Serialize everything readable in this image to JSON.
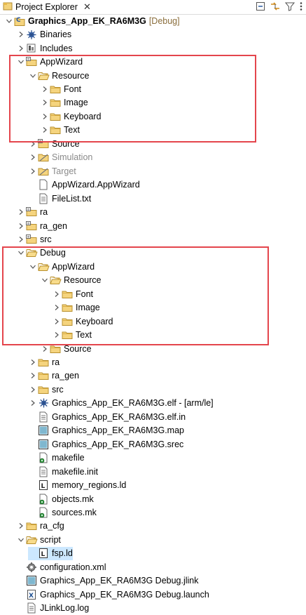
{
  "view": {
    "tab_label": "Project Explorer",
    "close_glyph": "✕"
  },
  "colors": {
    "folder": "#e6b84a",
    "highlight": "#e4454c",
    "muted_text": "#8a8a8a",
    "decoration": "#8a6d3b"
  },
  "tree": [
    {
      "label": "Graphics_App_EK_RA6M3G",
      "decoration": "[Debug]",
      "icon": "project-icon",
      "expanded": true,
      "depth": 0,
      "bold": true
    },
    {
      "label": "Binaries",
      "icon": "binaries-icon",
      "expanded": false,
      "depth": 1
    },
    {
      "label": "Includes",
      "icon": "includes-icon",
      "expanded": false,
      "depth": 1
    },
    {
      "label": "AppWizard",
      "icon": "source-folder-icon",
      "expanded": true,
      "depth": 1
    },
    {
      "label": "Resource",
      "icon": "folder-open-icon",
      "expanded": true,
      "depth": 2
    },
    {
      "label": "Font",
      "icon": "folder-icon",
      "expanded": false,
      "depth": 3
    },
    {
      "label": "Image",
      "icon": "folder-icon",
      "expanded": false,
      "depth": 3
    },
    {
      "label": "Keyboard",
      "icon": "folder-icon",
      "expanded": false,
      "depth": 3
    },
    {
      "label": "Text",
      "icon": "folder-icon",
      "expanded": false,
      "depth": 3
    },
    {
      "label": "Source",
      "icon": "source-folder-icon",
      "expanded": false,
      "depth": 2
    },
    {
      "label": "Simulation",
      "icon": "excluded-folder-icon",
      "expanded": false,
      "depth": 2,
      "muted": true
    },
    {
      "label": "Target",
      "icon": "excluded-folder-icon",
      "expanded": false,
      "depth": 2,
      "muted": true
    },
    {
      "label": "AppWizard.AppWizard",
      "icon": "file-icon",
      "depth": 2
    },
    {
      "label": "FileList.txt",
      "icon": "text-file-icon",
      "depth": 2
    },
    {
      "label": "ra",
      "icon": "source-folder-icon",
      "expanded": false,
      "depth": 1
    },
    {
      "label": "ra_gen",
      "icon": "source-folder-icon",
      "expanded": false,
      "depth": 1
    },
    {
      "label": "src",
      "icon": "source-folder-icon",
      "expanded": false,
      "depth": 1
    },
    {
      "label": "Debug",
      "icon": "folder-open-icon",
      "expanded": true,
      "depth": 1
    },
    {
      "label": "AppWizard",
      "icon": "folder-open-icon",
      "expanded": true,
      "depth": 2
    },
    {
      "label": "Resource",
      "icon": "folder-open-icon",
      "expanded": true,
      "depth": 3
    },
    {
      "label": "Font",
      "icon": "folder-icon",
      "expanded": false,
      "depth": 4
    },
    {
      "label": "Image",
      "icon": "folder-icon",
      "expanded": false,
      "depth": 4
    },
    {
      "label": "Keyboard",
      "icon": "folder-icon",
      "expanded": false,
      "depth": 4
    },
    {
      "label": "Text",
      "icon": "folder-icon",
      "expanded": false,
      "depth": 4
    },
    {
      "label": "Source",
      "icon": "folder-icon",
      "expanded": false,
      "depth": 3
    },
    {
      "label": "ra",
      "icon": "folder-icon",
      "expanded": false,
      "depth": 2
    },
    {
      "label": "ra_gen",
      "icon": "folder-icon",
      "expanded": false,
      "depth": 2
    },
    {
      "label": "src",
      "icon": "folder-icon",
      "expanded": false,
      "depth": 2
    },
    {
      "label": "Graphics_App_EK_RA6M3G.elf - [arm/le]",
      "icon": "elf-binary-icon",
      "expanded": false,
      "depth": 2
    },
    {
      "label": "Graphics_App_EK_RA6M3G.elf.in",
      "icon": "text-file-icon",
      "depth": 2
    },
    {
      "label": "Graphics_App_EK_RA6M3G.map",
      "icon": "map-file-icon",
      "depth": 2
    },
    {
      "label": "Graphics_App_EK_RA6M3G.srec",
      "icon": "map-file-icon",
      "depth": 2
    },
    {
      "label": "makefile",
      "icon": "makefile-icon",
      "depth": 2
    },
    {
      "label": "makefile.init",
      "icon": "text-file-icon",
      "depth": 2
    },
    {
      "label": "memory_regions.ld",
      "icon": "linker-file-icon",
      "depth": 2
    },
    {
      "label": "objects.mk",
      "icon": "makefile-icon",
      "depth": 2
    },
    {
      "label": "sources.mk",
      "icon": "makefile-icon",
      "depth": 2
    },
    {
      "label": "ra_cfg",
      "icon": "folder-icon",
      "expanded": false,
      "depth": 1
    },
    {
      "label": "script",
      "icon": "folder-open-icon",
      "expanded": true,
      "depth": 1
    },
    {
      "label": "fsp.ld",
      "icon": "linker-file-icon",
      "depth": 2,
      "selected": true
    },
    {
      "label": "configuration.xml",
      "icon": "gear-file-icon",
      "depth": 1
    },
    {
      "label": "Graphics_App_EK_RA6M3G Debug.jlink",
      "icon": "map-file-icon",
      "depth": 1
    },
    {
      "label": "Graphics_App_EK_RA6M3G Debug.launch",
      "icon": "launch-file-icon",
      "depth": 1
    },
    {
      "label": "JLinkLog.log",
      "icon": "text-file-icon",
      "depth": 1
    }
  ]
}
